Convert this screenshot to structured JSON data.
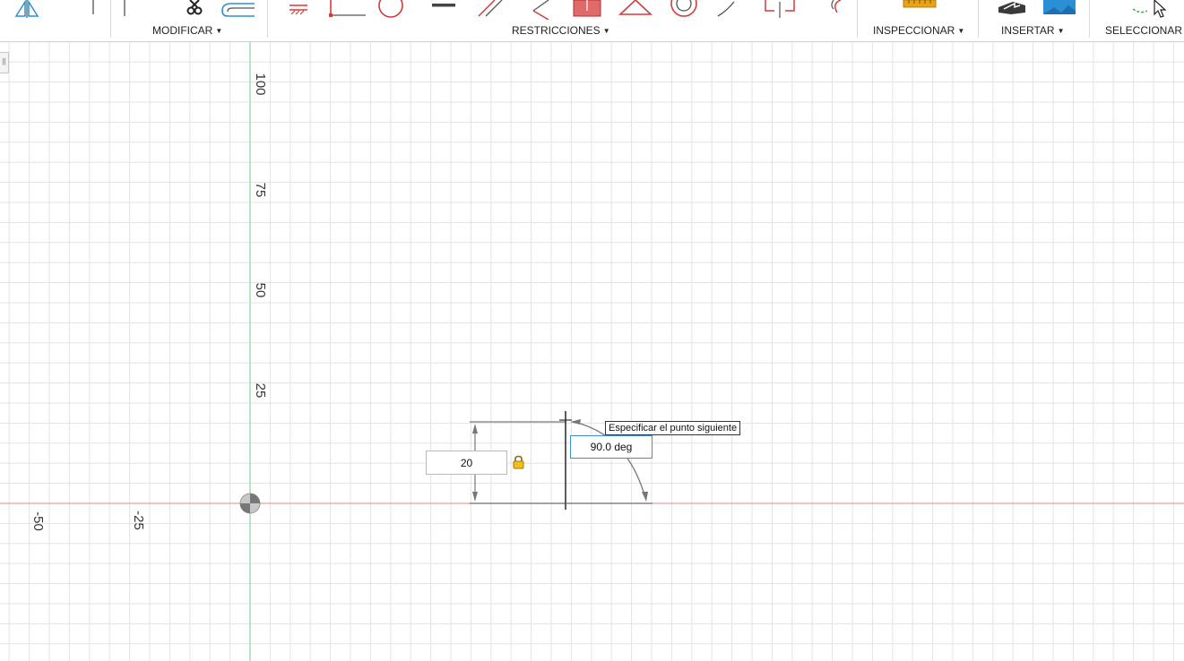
{
  "toolbar": {
    "groups": [
      {
        "id": "modificar",
        "label": "MODIFICAR"
      },
      {
        "id": "restricciones",
        "label": "RESTRICCIONES"
      },
      {
        "id": "inspeccionar",
        "label": "INSPECCIONAR"
      },
      {
        "id": "insertar",
        "label": "INSERTAR"
      },
      {
        "id": "seleccionar",
        "label": "SELECCIONAR"
      }
    ],
    "caret": "▼"
  },
  "canvas": {
    "vertical_axis_labels": [
      "100",
      "75",
      "50",
      "25"
    ],
    "horizontal_axis_labels": [
      "-50",
      "-25"
    ],
    "axis_colors": {
      "x": "#e8a0a0",
      "y": "#8fdc9a"
    },
    "grid_color": "#e3e3e3",
    "left_tab_glyph": "||"
  },
  "sketch": {
    "length_value": "20",
    "angle_value": "90.0 deg",
    "tooltip": "Especificar el punto siguiente",
    "lock_icon": "lock-icon"
  },
  "colors": {
    "constraint_red": "#d23c3c",
    "inspect_orange": "#e8a317",
    "insert_blue": "#2b8fd6",
    "select_green": "#3bb24a"
  }
}
